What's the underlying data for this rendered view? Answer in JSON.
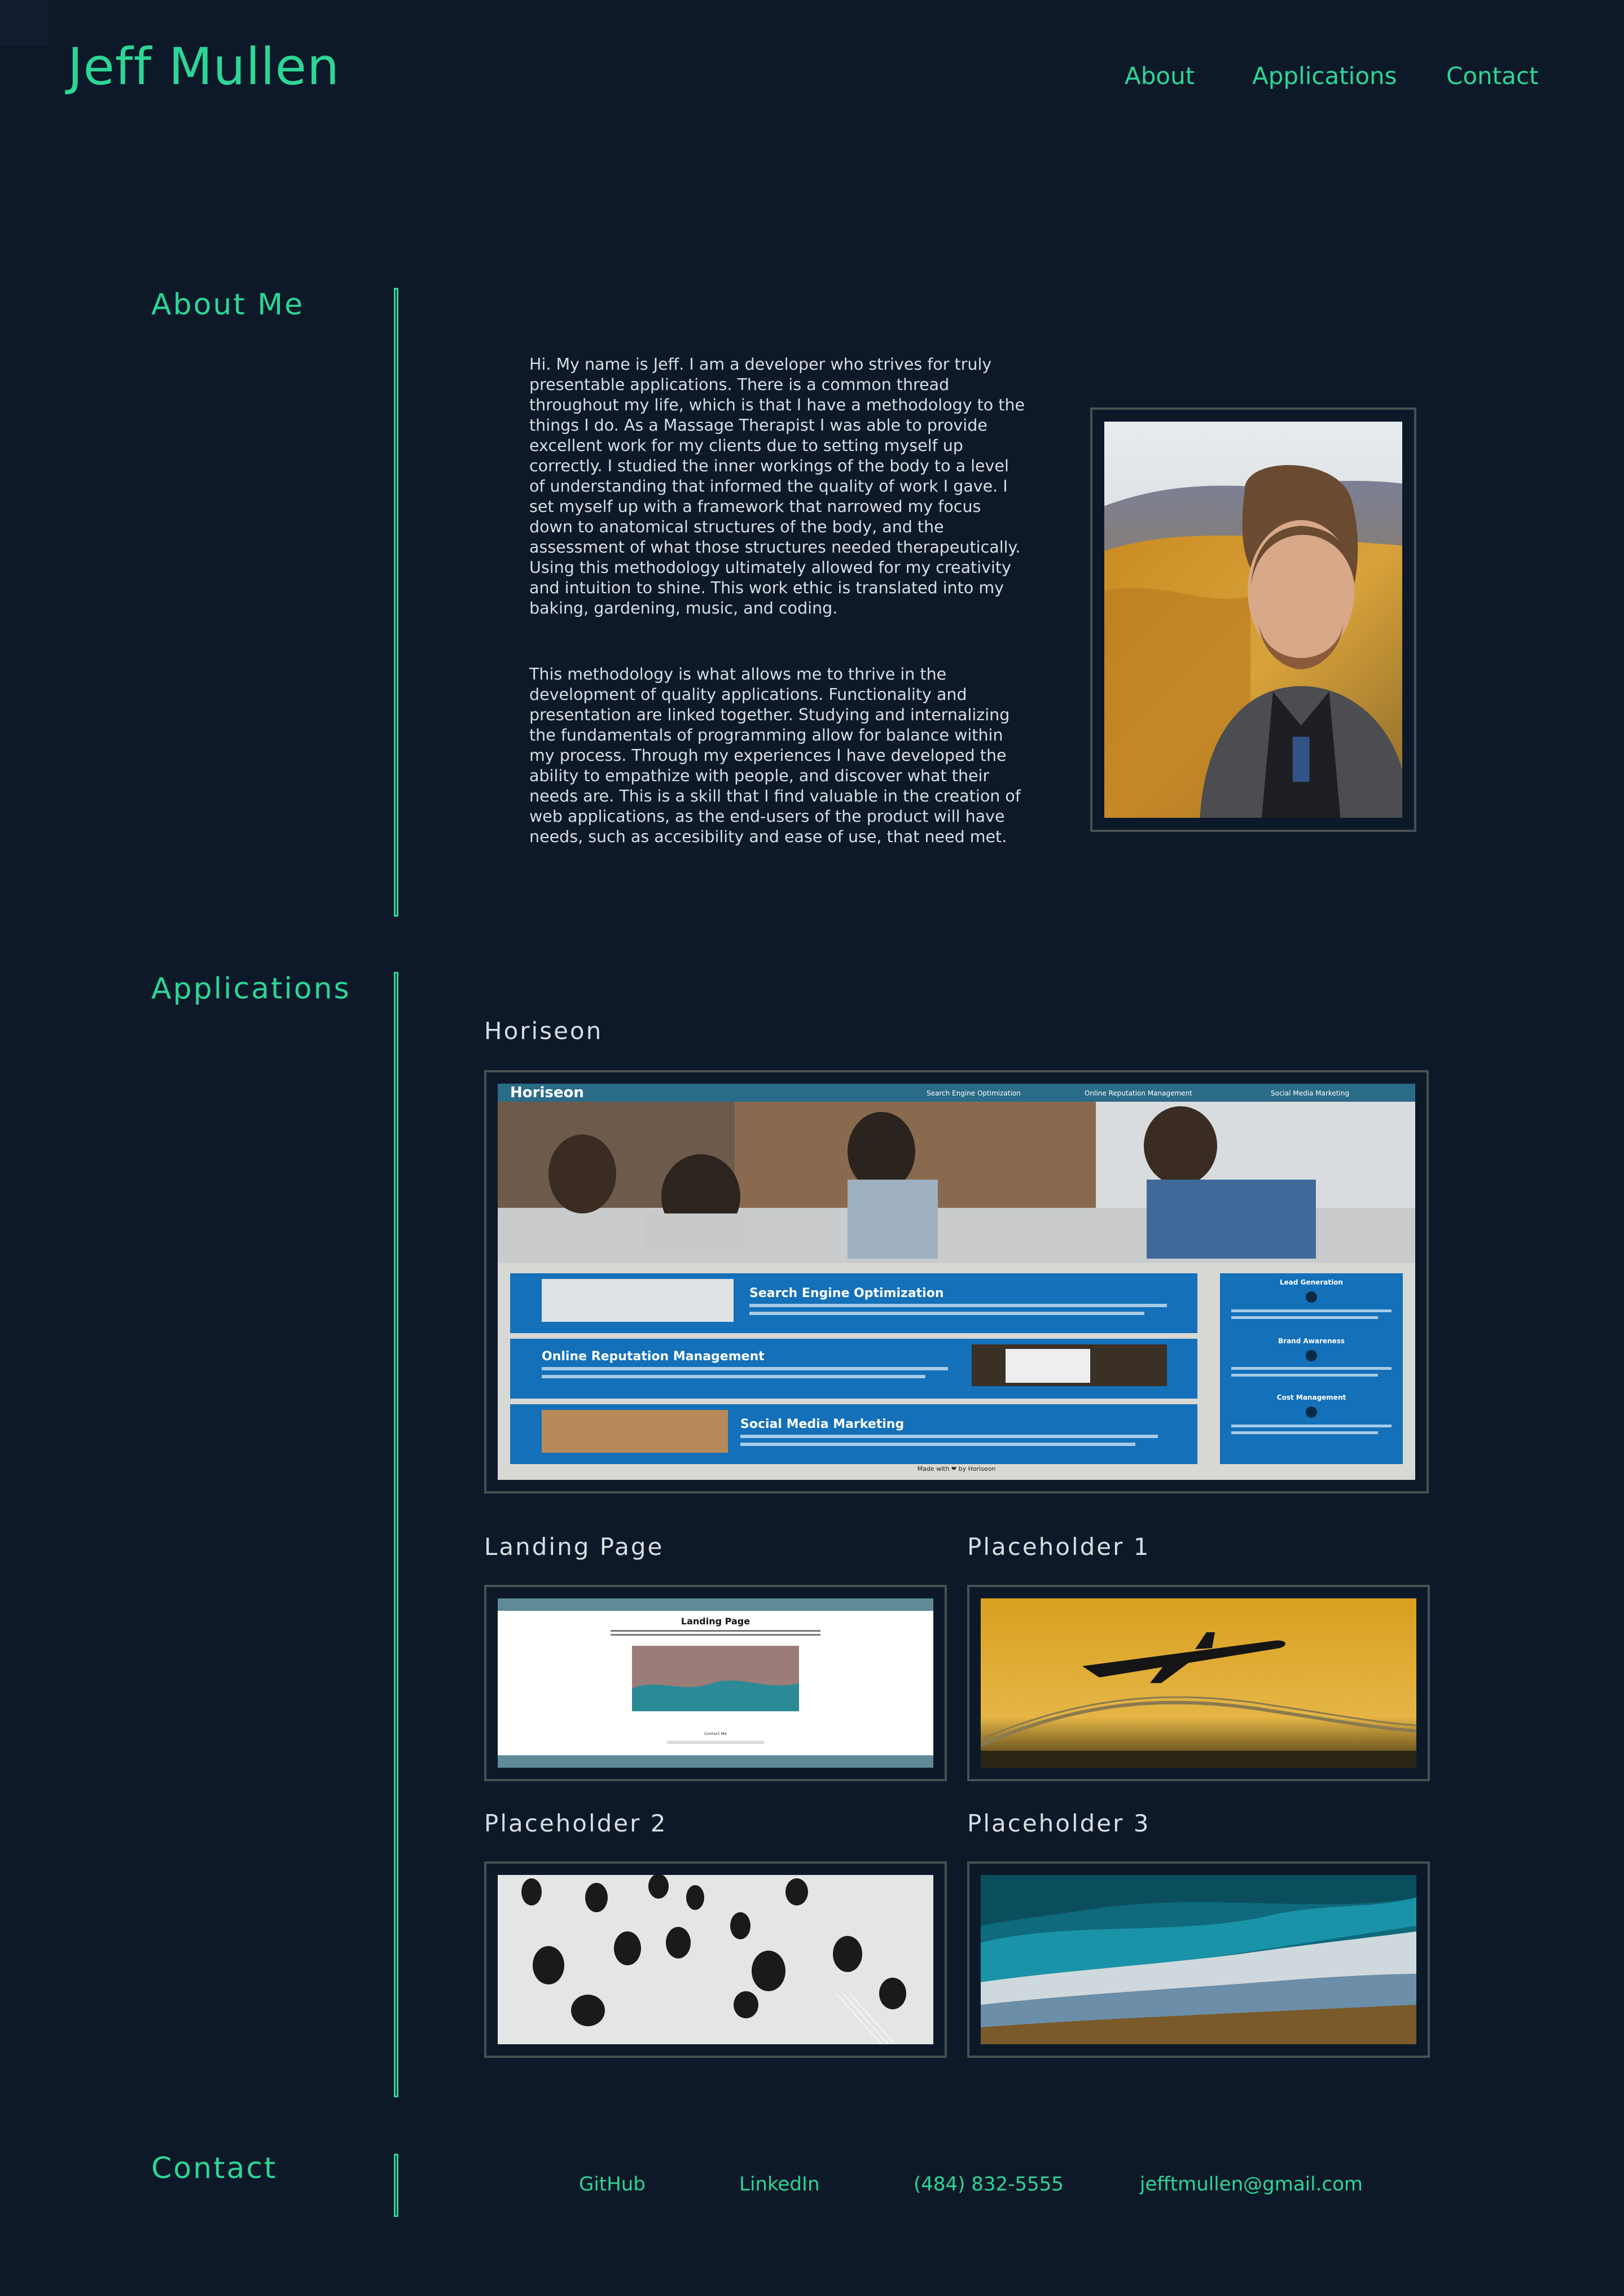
{
  "header": {
    "brand": "Jeff Mullen",
    "nav": [
      "About",
      "Applications",
      "Contact"
    ]
  },
  "about": {
    "title": "About Me",
    "paragraphs": [
      "Hi. My name is Jeff. I am a developer who strives for truly presentable applications. There is a common thread throughout my life, which is that I have a methodology to the things I do. As a Massage Therapist I was able to provide excellent work for my clients due to setting myself up correctly. I studied the inner workings of the body to a level of understanding that informed the quality of work I gave. I set myself up with a framework that narrowed my focus down to anatomical structures of the body, and the assessment of what those structures needed therapeutically. Using this methodology ultimately allowed for my creativity and intuition to shine. This work ethic is translated into my baking, gardening, music, and coding.",
      "This methodology is what allows me to thrive in the development of quality applications. Functionality and presentation are linked together. Studying and internalizing the fundamentals of programming allow for balance within my process. Through my experiences I have developed the ability to empathize with people, and discover what their needs are. This is a skill that I find valuable in the creation of web applications, as the end-users of the product will have needs, such as accesibility and ease of use, that need met."
    ]
  },
  "applications": {
    "title": "Applications",
    "featured": {
      "name": "Horiseon",
      "screenshot": {
        "brand": "Horiseon",
        "nav": [
          "Search Engine Optimization",
          "Online Reputation Management",
          "Social Media Marketing"
        ],
        "sections": [
          "Search Engine Optimization",
          "Online Reputation Management",
          "Social Media Marketing"
        ],
        "sidebar": [
          "Lead Generation",
          "Brand Awareness",
          "Cost Management"
        ],
        "footer": "Made with ❤ by Horiseon"
      }
    },
    "items": [
      {
        "name": "Landing Page",
        "screenshot_title": "Landing Page",
        "screenshot_label": "Contact Me"
      },
      {
        "name": "Placeholder 1"
      },
      {
        "name": "Placeholder 2"
      },
      {
        "name": "Placeholder 3"
      }
    ]
  },
  "contact": {
    "title": "Contact",
    "links": [
      "GitHub",
      "LinkedIn",
      "(484) 832-5555",
      "jefftmullen@gmail.com"
    ]
  },
  "colors": {
    "background": "#0d1929",
    "accent": "#2dd695",
    "text": "#d8dde2",
    "frame_border": "#4a5052"
  }
}
